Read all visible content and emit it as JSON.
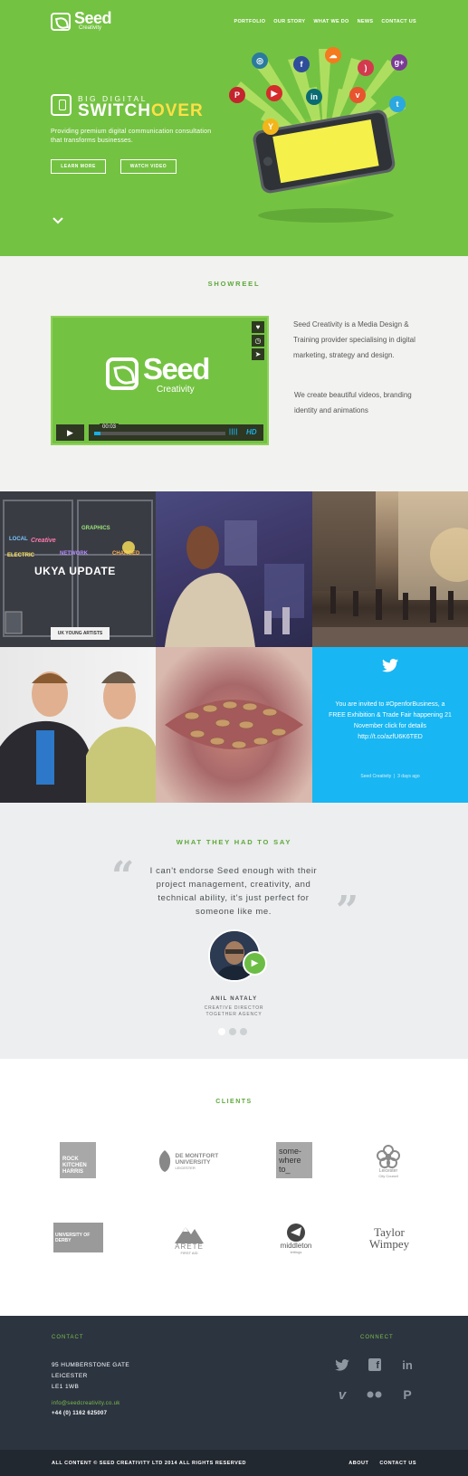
{
  "colors": {
    "brand_green": "#74c242",
    "heading_green": "#5ea83a",
    "twitter_blue": "#18b6f2",
    "footer_bg": "#2c3440",
    "bottom_bg": "#222830"
  },
  "logo": {
    "word": "Seed",
    "sub": "Creativity"
  },
  "nav": [
    "PORTFOLIO",
    "OUR STORY",
    "WHAT WE DO",
    "NEWS",
    "CONTACT US"
  ],
  "hero": {
    "subtitle": "BIG DIGITAL",
    "title_part1": "SWITCH",
    "title_part2": "OVER",
    "description": "Providing premium digital communication consultation that transforms businesses.",
    "learn_more": "LEARN MORE",
    "watch_video": "WATCH VIDEO",
    "social_icons": [
      "instagram-icon",
      "facebook-icon",
      "soundcloud-icon",
      "rss-icon",
      "google-plus-icon",
      "pinterest-icon",
      "youtube-icon",
      "linkedin-icon",
      "vine-icon",
      "twitter-icon",
      "yelp-icon"
    ]
  },
  "showreel": {
    "title": "SHOWREEL",
    "video_logo_word": "Seed",
    "video_logo_sub": "Creativity",
    "time": "00:03",
    "hd": "HD",
    "progress": 0.05,
    "para1": "Seed Creativity is a Media Design & Training provider specialising in digital marketing, strategy and design.",
    "para2": "We create beautiful videos, branding identity and animations"
  },
  "grid": {
    "ukya_title": "UKYA UPDATE",
    "ukya_badge": "UK YOUNG ARTISTS",
    "tweet_text": "You are invited to #OpenforBusiness, a FREE Exhibition & Trade Fair happening 21 November click for details http://t.co/azfU6K6TED",
    "tweet_author": "Seed Creativity",
    "tweet_time": "3 days ago"
  },
  "testimonial": {
    "title": "WHAT THEY HAD TO SAY",
    "quote": "I can't endorse Seed enough with their project management, creativity, and technical ability, it's just perfect for someone like me.",
    "name": "ANIL NATALY",
    "role": "CREATIVE DIRECTOR",
    "agency": "TOGETHER AGENCY",
    "dots": 3,
    "active_dot": 1
  },
  "clients": {
    "title": "CLIENTS",
    "logos": [
      {
        "name": "ROCK KITCHEN HARRIS"
      },
      {
        "name": "DE MONTFORT UNIVERSITY",
        "sub": "LEICESTER"
      },
      {
        "name": "some-where to_"
      },
      {
        "name": "Leicester",
        "sub": "City Council"
      },
      {
        "name": "UNIVERSITY OF DERBY"
      },
      {
        "name": "ARETE",
        "sub": "FIRST AID"
      },
      {
        "name": "middleton",
        "sub": "lettings"
      },
      {
        "name": "Taylor",
        "sub": "Wimpey"
      }
    ]
  },
  "footer": {
    "contact_heading": "CONTACT",
    "connect_heading": "CONNECT",
    "address": [
      "95 HUMBERSTONE GATE",
      "LEICESTER",
      "LE1 1WB"
    ],
    "email": "info@seedcreativity.co.uk",
    "phone": "+44 (0) 1162 625007",
    "social": [
      "twitter-icon",
      "facebook-icon",
      "linkedin-icon",
      "vimeo-icon",
      "flickr-icon",
      "pinterest-icon"
    ],
    "copyright": "ALL CONTENT © SEED CREATIVITY LTD 2014 ALL RIGHTS RESERVED",
    "links": [
      "ABOUT",
      "CONTACT US"
    ]
  }
}
